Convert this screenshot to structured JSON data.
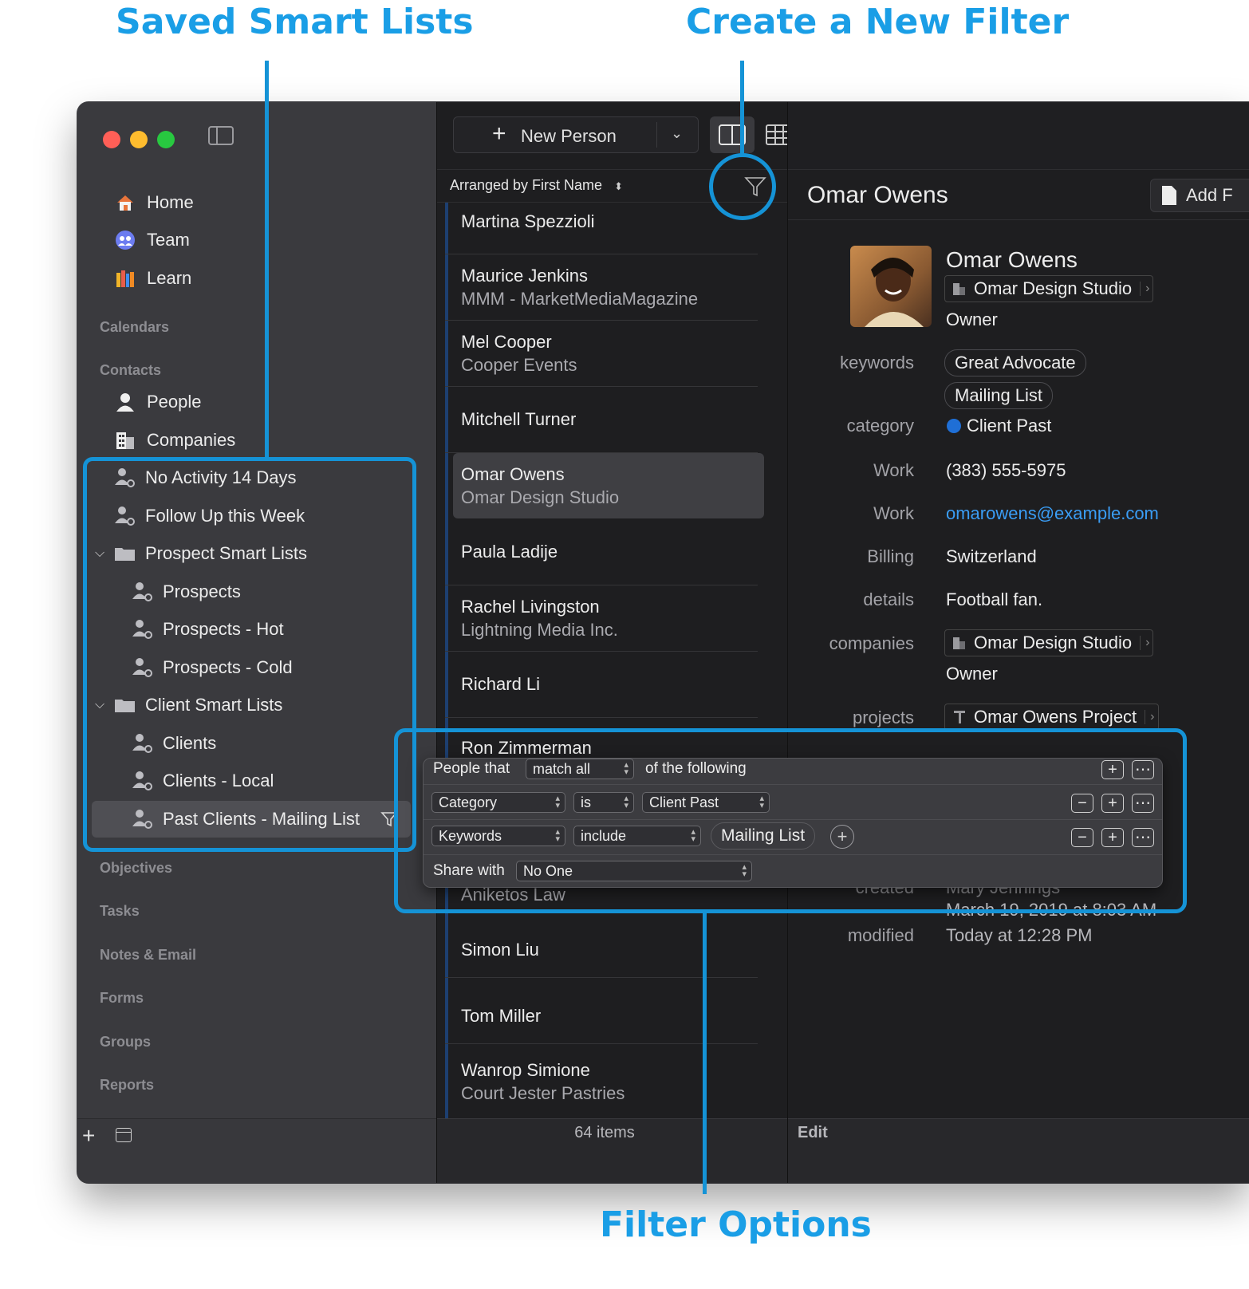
{
  "callouts": {
    "saved_smart_lists": "Saved Smart Lists",
    "create_new_filter": "Create a New Filter",
    "filter_options": "Filter Options"
  },
  "accent_color": "#1a9ee6",
  "toolbar": {
    "new_person_label": "New Person"
  },
  "sidebar": {
    "nav": [
      {
        "label": "Home",
        "icon": "house-icon"
      },
      {
        "label": "Team",
        "icon": "team-icon"
      },
      {
        "label": "Learn",
        "icon": "books-icon"
      }
    ],
    "sections": {
      "calendars": "Calendars",
      "contacts": "Contacts",
      "objectives": "Objectives",
      "tasks": "Tasks",
      "notes_email": "Notes & Email",
      "forms": "Forms",
      "groups": "Groups",
      "reports": "Reports"
    },
    "contacts": [
      {
        "label": "People",
        "icon": "person-icon"
      },
      {
        "label": "Companies",
        "icon": "building-icon"
      }
    ],
    "smart_lists": [
      "No Activity 14 Days",
      "Follow Up this Week",
      "Prospect Smart Lists",
      "Prospects",
      "Prospects - Hot",
      "Prospects - Cold",
      "Client Smart Lists",
      "Clients",
      "Clients - Local",
      "Past Clients - Mailing List"
    ]
  },
  "list": {
    "arranged_by": "Arranged by First Name",
    "rows": [
      {
        "name": "Martina Spezzioli",
        "company": ""
      },
      {
        "name": "Maurice Jenkins",
        "company": "MMM - MarketMediaMagazine"
      },
      {
        "name": "Mel Cooper",
        "company": "Cooper Events"
      },
      {
        "name": "Mitchell Turner",
        "company": ""
      },
      {
        "name": "Omar Owens",
        "company": "Omar Design Studio"
      },
      {
        "name": "Paula Ladije",
        "company": ""
      },
      {
        "name": "Rachel Livingston",
        "company": "Lightning Media Inc."
      },
      {
        "name": "Richard Li",
        "company": ""
      },
      {
        "name": "Ron Zimmerman",
        "company": ""
      },
      {
        "name": "",
        "company": "Aniketos Law"
      },
      {
        "name": "Simon Liu",
        "company": ""
      },
      {
        "name": "Tom Miller",
        "company": ""
      },
      {
        "name": "Wanrop Simione",
        "company": "Court Jester Pastries"
      }
    ],
    "count": "64 items"
  },
  "detail": {
    "title": "Omar Owens",
    "add_button": "Add F",
    "name": "Omar Owens",
    "company": "Omar Design Studio",
    "role": "Owner",
    "labels": {
      "keywords": "keywords",
      "category": "category",
      "work_phone": "Work",
      "work_email": "Work",
      "billing": "Billing",
      "details": "details",
      "companies": "companies",
      "projects": "projects",
      "created": "created",
      "modified": "modified"
    },
    "keywords": [
      "Great Advocate",
      "Mailing List"
    ],
    "category": "Client Past",
    "category_color": "#1f6fd6",
    "phone": "(383) 555-5975",
    "email": "omarowens@example.com",
    "billing": "Switzerland",
    "details_text": "Football fan.",
    "companies_value": "Omar Design Studio",
    "companies_role": "Owner",
    "project": "Omar Owens Project",
    "created_by": "Mary Jennings",
    "created_date": "March 19, 2019 at 8:03 AM",
    "modified": "Today at 12:28 PM",
    "edit_label": "Edit"
  },
  "filter": {
    "lead": "People that",
    "match": "match all",
    "tail": "of the following",
    "rule1": {
      "field": "Category",
      "op": "is",
      "value": "Client Past"
    },
    "rule2": {
      "field": "Keywords",
      "op": "include",
      "value": "Mailing List"
    },
    "share_label": "Share with",
    "share_value": "No One"
  }
}
